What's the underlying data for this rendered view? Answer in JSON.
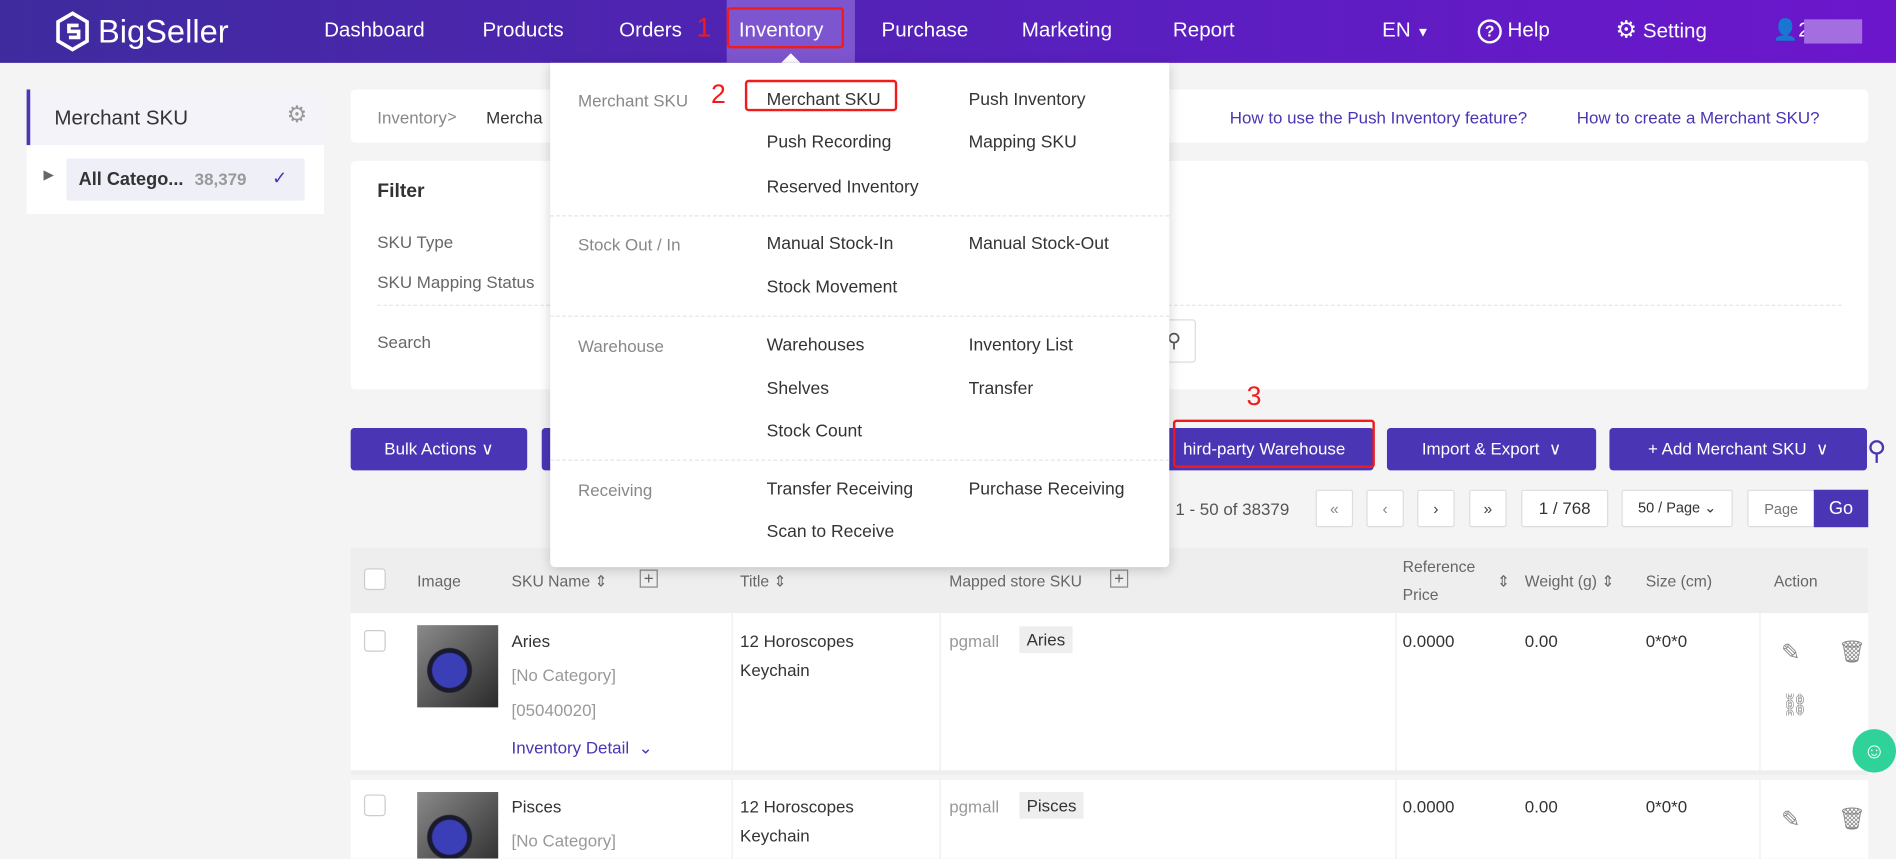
{
  "header": {
    "logo": "BigSeller",
    "nav": [
      "Dashboard",
      "Products",
      "Orders",
      "Inventory",
      "Purchase",
      "Marketing",
      "Report"
    ],
    "active": "Inventory",
    "lang": "EN",
    "help": "Help",
    "setting": "Setting",
    "user_initial": "2"
  },
  "annotations": {
    "one": "1",
    "two": "2",
    "three": "3",
    "color": "#f21b1b"
  },
  "sidebar": {
    "title": "Merchant SKU",
    "category": "All Catego...",
    "count": "38,379"
  },
  "breadcrumb": {
    "root": "Inventory",
    "sep": ">",
    "current": "Mercha"
  },
  "help_links": [
    "How to use the Push Inventory feature?",
    "How to create a Merchant SKU?"
  ],
  "filter": {
    "title": "Filter",
    "sku_type": "SKU Type",
    "mapping_status": "SKU Mapping Status",
    "search": "Search"
  },
  "actions": {
    "bulk": "Bulk Actions",
    "third_party": "hird-party Warehouse",
    "import_export": "Import & Export",
    "add": "+ Add Merchant SKU"
  },
  "pagination": {
    "range": "1 - 50 of 38379",
    "first": "«",
    "prev": "‹",
    "next": "›",
    "last": "»",
    "page": "1 / 768",
    "per_page": "50 / Page",
    "page_placeholder": "Page",
    "go": "Go"
  },
  "dropdown": {
    "groups": [
      {
        "label": "Merchant SKU",
        "items": [
          "Merchant SKU",
          "Push Inventory",
          "Push Recording",
          "Mapping SKU",
          "Reserved Inventory"
        ]
      },
      {
        "label": "Stock Out / In",
        "items": [
          "Manual Stock-In",
          "Manual Stock-Out",
          "Stock Movement"
        ]
      },
      {
        "label": "Warehouse",
        "items": [
          "Warehouses",
          "Inventory List",
          "Shelves",
          "Transfer",
          "Stock Count"
        ]
      },
      {
        "label": "Receiving",
        "items": [
          "Transfer Receiving",
          "Purchase Receiving",
          "Scan to Receive"
        ]
      }
    ]
  },
  "table": {
    "headers": {
      "image": "Image",
      "sku_name": "SKU Name",
      "title": "Title",
      "mapped": "Mapped store SKU",
      "ref1": "Reference",
      "ref2": "Price",
      "weight": "Weight (g)",
      "size": "Size (cm)",
      "action": "Action"
    },
    "rows": [
      {
        "name": "Aries",
        "category": "[No Category]",
        "code": "[05040020]",
        "detail": "Inventory Detail",
        "title1": "12 Horoscopes",
        "title2": "Keychain",
        "store": "pgmall",
        "store_sku": "Aries",
        "price": "0.0000",
        "weight": "0.00",
        "size": "0*0*0"
      },
      {
        "name": "Pisces",
        "category": "[No Category]",
        "title1": "12 Horoscopes",
        "title2": "Keychain",
        "store": "pgmall",
        "store_sku": "Pisces",
        "price": "0.0000",
        "weight": "0.00",
        "size": "0*0*0"
      }
    ]
  },
  "colors": {
    "brand": "#4a35b5",
    "link": "#4a35b5"
  }
}
